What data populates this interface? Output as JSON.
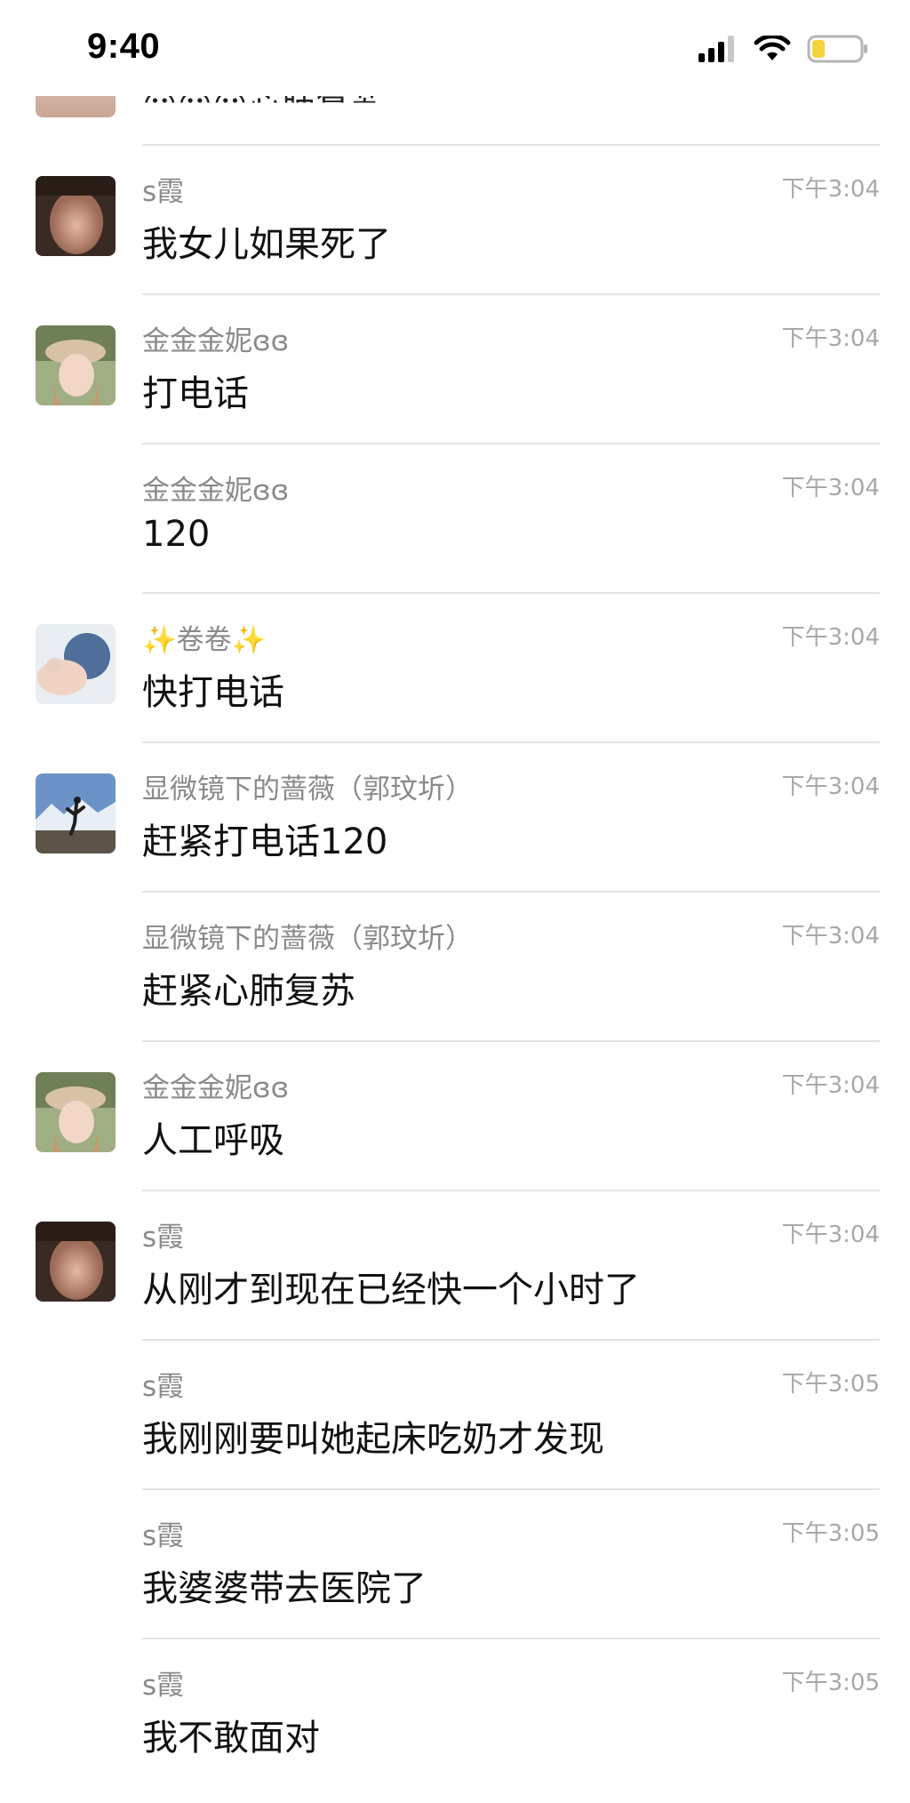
{
  "status_bar": {
    "time": "9:40"
  },
  "partial_message": {
    "text": "😮😮😮心肺复苏"
  },
  "messages": [
    {
      "sender": "s霞",
      "time": "下午3:04",
      "text": "我女儿如果死了",
      "avatar": "avatar-s-xia"
    },
    {
      "sender": "金金金妮ɞɞ",
      "time": "下午3:04",
      "text": "打电话",
      "avatar": "avatar-jinni"
    },
    {
      "sender": "金金金妮ɞɞ",
      "time": "下午3:04",
      "text": "120",
      "avatar": ""
    },
    {
      "sender": "✨卷卷✨",
      "time": "下午3:04",
      "text": "快打电话",
      "avatar": "avatar-juanjuan"
    },
    {
      "sender": "显微镜下的蔷薇（郭玟圻）",
      "time": "下午3:04",
      "text": "赶紧打电话120",
      "avatar": "avatar-qiangwei"
    },
    {
      "sender": "显微镜下的蔷薇（郭玟圻）",
      "time": "下午3:04",
      "text": "赶紧心肺复苏",
      "avatar": ""
    },
    {
      "sender": "金金金妮ɞɞ",
      "time": "下午3:04",
      "text": "人工呼吸",
      "avatar": "avatar-jinni"
    },
    {
      "sender": "s霞",
      "time": "下午3:04",
      "text": "从刚才到现在已经快一个小时了",
      "avatar": "avatar-s-xia"
    },
    {
      "sender": "s霞",
      "time": "下午3:05",
      "text": "我刚刚要叫她起床吃奶才发现",
      "avatar": ""
    },
    {
      "sender": "s霞",
      "time": "下午3:05",
      "text": "我婆婆带去医院了",
      "avatar": ""
    },
    {
      "sender": "s霞",
      "time": "下午3:05",
      "text": "我不敢面对",
      "avatar": ""
    }
  ]
}
